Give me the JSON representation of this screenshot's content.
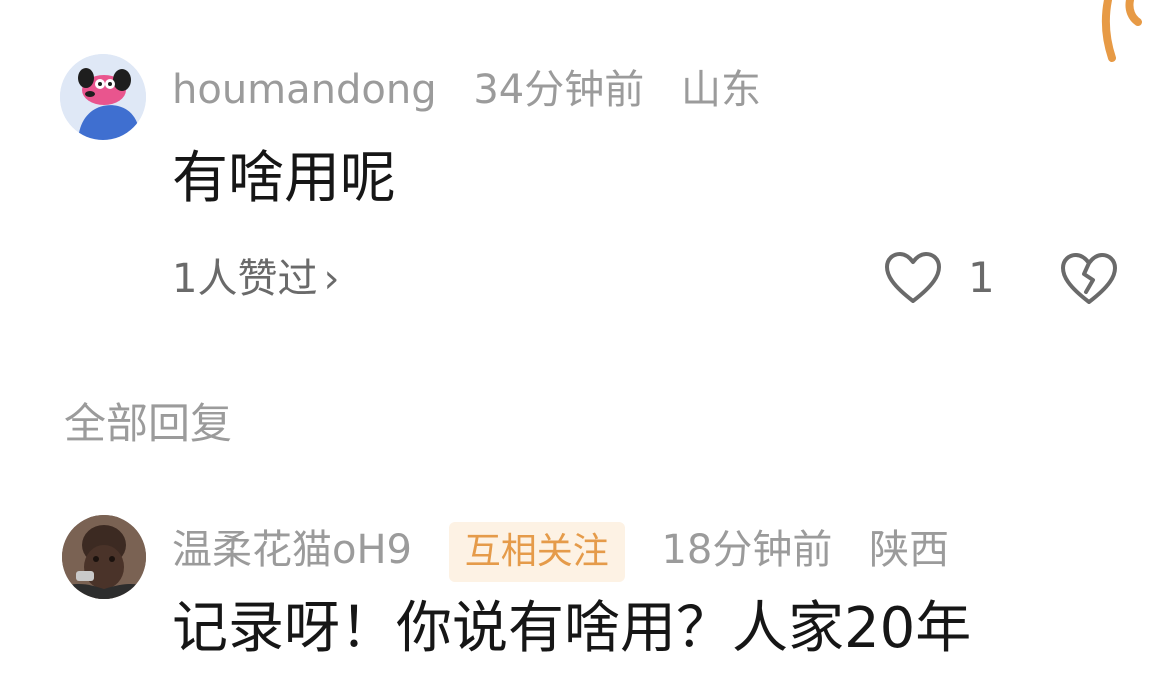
{
  "comment": {
    "username": "houmandong",
    "time": "34分钟前",
    "location": "山东",
    "text": "有啥用呢",
    "liked_by": "1人赞过",
    "like_count": "1",
    "icons": {
      "like": "heart-outline-icon",
      "dislike": "broken-heart-icon",
      "chevron": "chevron-right-icon"
    }
  },
  "replies_section": {
    "title": "全部回复"
  },
  "reply": {
    "username": "温柔花猫oH9",
    "tag": "互相关注",
    "time": "18分钟前",
    "location": "陕西",
    "text": "记录呀！你说有啥用？人家20年"
  },
  "colors": {
    "meta": "#9b9b9b",
    "tag_text": "#e59b4a",
    "tag_bg": "#fdf2e4",
    "doodle": "#e79a45"
  }
}
